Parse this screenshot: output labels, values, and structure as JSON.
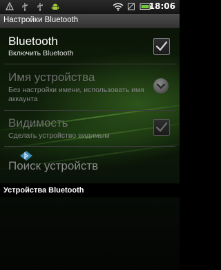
{
  "status_bar": {
    "time": "18:06",
    "icons": [
      "warning-icon",
      "usb-icon",
      "usb-icon",
      "android-icon",
      "wifi-icon",
      "sim-icon",
      "battery-icon"
    ]
  },
  "title_bar": {
    "title": "Настройки Bluetooth"
  },
  "settings": {
    "bluetooth": {
      "title": "Bluetooth",
      "summary": "Включить Bluetooth",
      "checked": true
    },
    "device_name": {
      "title": "Имя устройства",
      "summary": "Без настройки имени, использовать имя аккаунта",
      "enabled": false
    },
    "visibility": {
      "title": "Видимость",
      "summary": "Сделать устройство видимым",
      "checked": true,
      "enabled": false
    },
    "search": {
      "title": "Поиск устройств",
      "enabled": false
    }
  },
  "devices_section": {
    "header": "Устройства Bluetooth"
  },
  "colors": {
    "background": "#0f1e0a",
    "accent_green": "#8cdc5a",
    "check_enabled": "#cfcfcf",
    "check_disabled": "#6a6a6a"
  }
}
